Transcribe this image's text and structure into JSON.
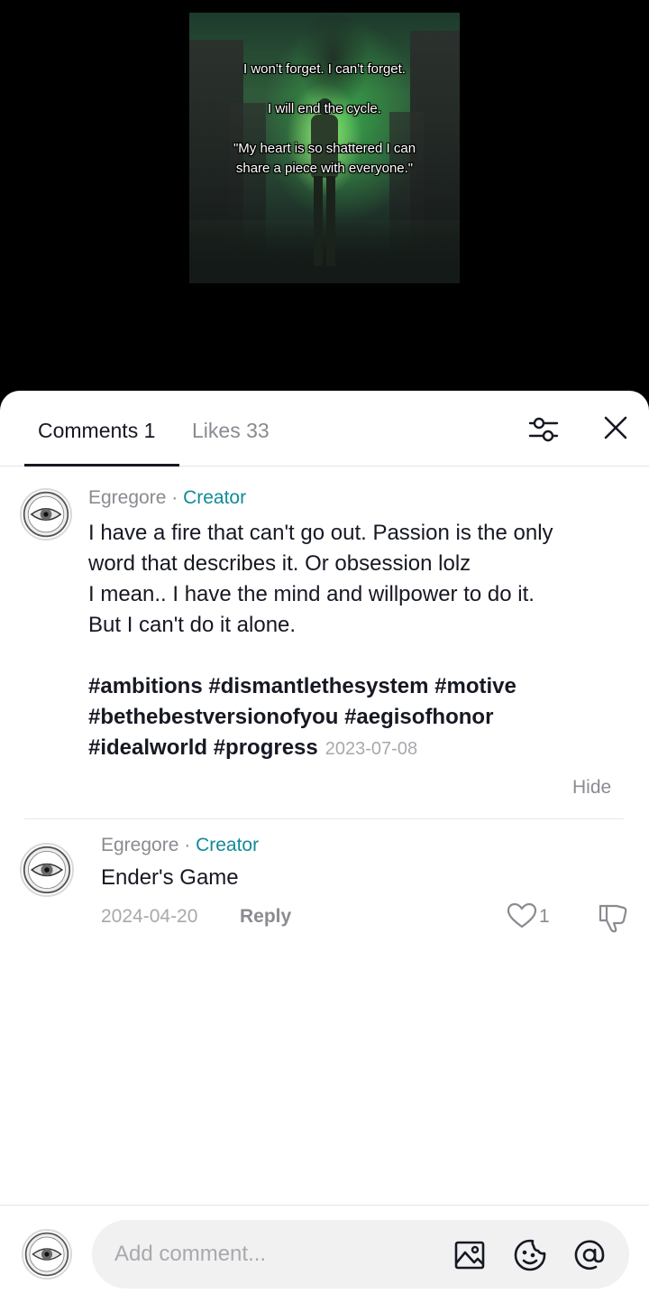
{
  "video": {
    "caption_lines": [
      "I won't forget. I can't forget.",
      "I will end the cycle.",
      "\"My heart is so shattered I can share a piece with everyone.\""
    ]
  },
  "tabs": {
    "comments_label": "Comments 1",
    "likes_label": "Likes 33",
    "active": "comments"
  },
  "icons": {
    "filter": "sliders-icon",
    "close": "close-icon",
    "image": "image-icon",
    "emoji": "emoji-icon",
    "mention": "at-icon",
    "like": "heart-icon",
    "dislike": "thumbs-down-icon"
  },
  "comments": [
    {
      "author": "Egregore",
      "separator": " · ",
      "badge": "Creator",
      "text_lines": [
        "I have a fire that can't go out. Passion is the only",
        "word that describes it. Or obsession lolz",
        "I mean.. I have the mind and willpower to do it.",
        "But I can't do it alone."
      ],
      "hashtag_lines": [
        "#ambitions #dismantlethesystem #motive",
        "#bethebestversionofyou #aegisofhonor",
        "#idealworld #progress"
      ],
      "date": "2023-07-08",
      "hide_label": "Hide"
    },
    {
      "author": "Egregore",
      "separator": " · ",
      "badge": "Creator",
      "text": "Ender's Game",
      "date": "2024-04-20",
      "reply_label": "Reply",
      "like_count": "1"
    }
  ],
  "composer": {
    "placeholder": "Add comment..."
  },
  "colors": {
    "creator_badge": "#128a9a",
    "text_primary": "#161823",
    "text_secondary": "#8a8b91",
    "sheet_bg": "#ffffff",
    "input_bg": "#f1f1f2"
  }
}
